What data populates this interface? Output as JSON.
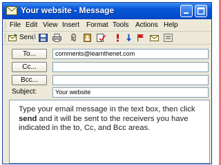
{
  "window": {
    "title": "Your website - Message"
  },
  "menu": {
    "items": [
      "File",
      "Edit",
      "View",
      "Insert",
      "Format",
      "Tools",
      "Actions",
      "Help"
    ],
    "underlined": [
      "F",
      "E",
      "V",
      "I",
      "o",
      "T",
      "A",
      "H"
    ]
  },
  "toolbar": {
    "send_label": "Send",
    "send_underlined": "S",
    "icons": [
      "save-icon",
      "print-icon",
      "attach-icon",
      "address-book-icon",
      "check-names-icon",
      "importance-high-icon",
      "importance-low-icon",
      "flag-icon",
      "envelope-icon",
      "options-icon"
    ]
  },
  "fields": {
    "to_button": "To...",
    "to_value": "comments@learnthenet.com",
    "cc_button": "Cc...",
    "bcc_button": "Bcc...",
    "subject_label": "Subject:",
    "subject_value": "Your website"
  },
  "caption": {
    "line1": "Type your email message in the text box, then click",
    "bold_word": "send",
    "line2_rest": " and it will be sent to the receivers you have",
    "line3": "indicated in the to, Cc, and Bcc areas."
  },
  "colors": {
    "titlebar": "#0450d0",
    "accent_bar": "#f07a80",
    "window_face": "#ece9d8"
  }
}
